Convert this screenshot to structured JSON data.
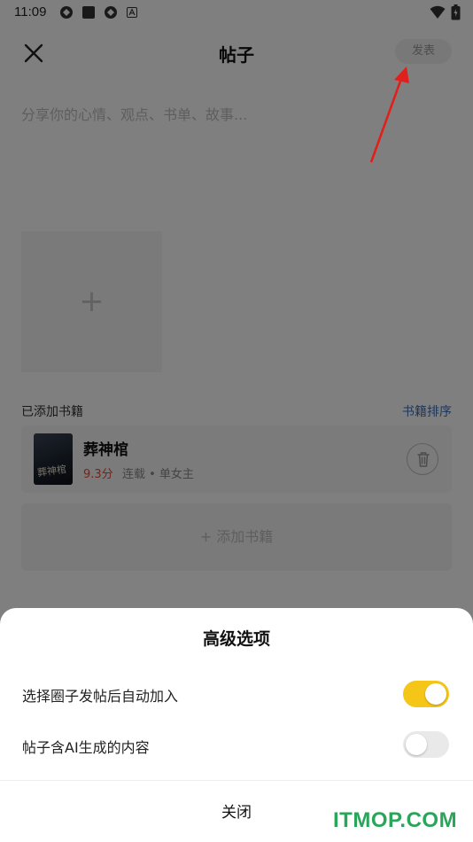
{
  "status_bar": {
    "time": "11:09"
  },
  "header": {
    "title": "帖子",
    "publish_label": "发表"
  },
  "editor": {
    "placeholder": "分享你的心情、观点、书单、故事..."
  },
  "books_section": {
    "title": "已添加书籍",
    "sort_label": "书籍排序",
    "books": [
      {
        "name": "葬神棺",
        "score": "9.3分",
        "meta": "连载 • 单女主"
      }
    ],
    "add_label": "+ 添加书籍"
  },
  "advanced_sheet": {
    "title": "高级选项",
    "options": [
      {
        "label": "选择圈子发帖后自动加入",
        "enabled": true
      },
      {
        "label": "帖子含AI生成的内容",
        "enabled": false
      }
    ],
    "close_label": "关闭"
  },
  "colors": {
    "accent": "#f5c518",
    "arrow": "#e0201c",
    "link": "#3b6fb8",
    "score": "#e04b3c"
  },
  "watermark": "ITMOP.COM"
}
